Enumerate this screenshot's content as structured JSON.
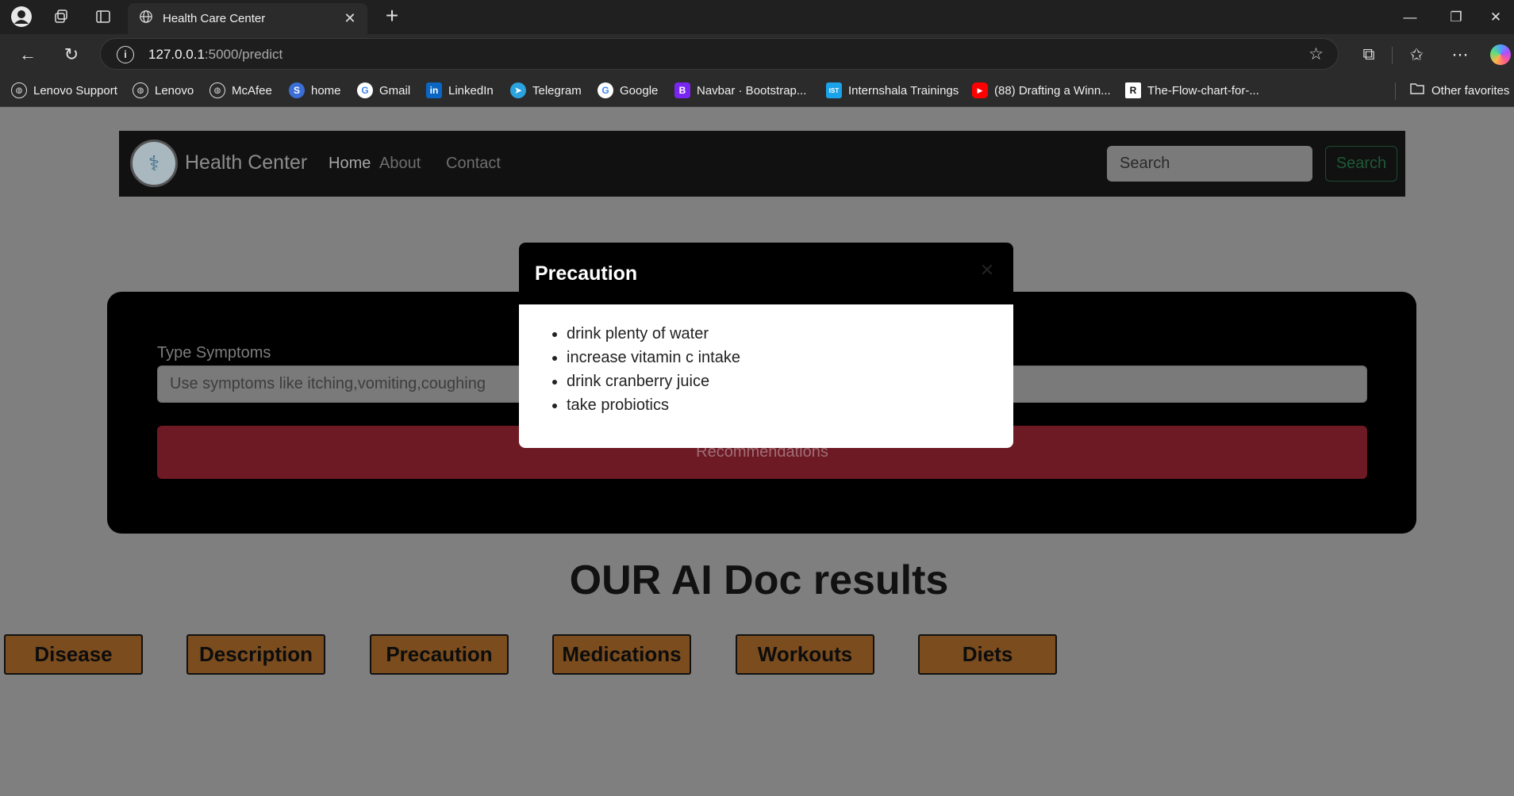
{
  "browser": {
    "tab_title": "Health Care Center",
    "url_host": "127.0.0.1",
    "url_path": ":5000/predict",
    "bookmarks": [
      {
        "label": "Lenovo Support",
        "icon": "globe-icon",
        "color": ""
      },
      {
        "label": "Lenovo",
        "icon": "globe-icon",
        "color": ""
      },
      {
        "label": "McAfee",
        "icon": "globe-icon",
        "color": ""
      },
      {
        "label": "home",
        "icon": "home-app-icon",
        "color": "#3b6fd8"
      },
      {
        "label": "Gmail",
        "icon": "google-icon",
        "color": "#ffffff"
      },
      {
        "label": "LinkedIn",
        "icon": "linkedin-icon",
        "color": "#0a66c2"
      },
      {
        "label": "Telegram",
        "icon": "telegram-icon",
        "color": "#2aa3df"
      },
      {
        "label": "Google",
        "icon": "google-icon",
        "color": "#ffffff"
      },
      {
        "label": "Navbar · Bootstrap...",
        "icon": "bootstrap-icon",
        "color": "#7a26f2"
      },
      {
        "label": "Internshala Trainings",
        "icon": "internshala-icon",
        "color": "#1aa3e8"
      },
      {
        "label": "(88) Drafting a Winn...",
        "icon": "youtube-icon",
        "color": "#ff0000"
      },
      {
        "label": "The-Flow-chart-for-...",
        "icon": "researchgate-icon",
        "color": "#ffffff"
      }
    ],
    "other_favorites": "Other favorites"
  },
  "navbar": {
    "brand": "Health Center",
    "links": [
      "Home",
      "About",
      "Contact"
    ],
    "search_placeholder": "Search",
    "search_button": "Search"
  },
  "form": {
    "label": "Type Symptoms",
    "placeholder": "Use symptoms like itching,vomiting,coughing",
    "button": "Recommendations"
  },
  "results": {
    "title": "OUR AI Doc results",
    "buttons": [
      "Disease",
      "Description",
      "Precaution",
      "Medications",
      "Workouts",
      "Diets"
    ]
  },
  "modal": {
    "title": "Precaution",
    "items": [
      "drink plenty of water",
      "increase vitamin c intake",
      "drink cranberry juice",
      "take probiotics"
    ]
  }
}
